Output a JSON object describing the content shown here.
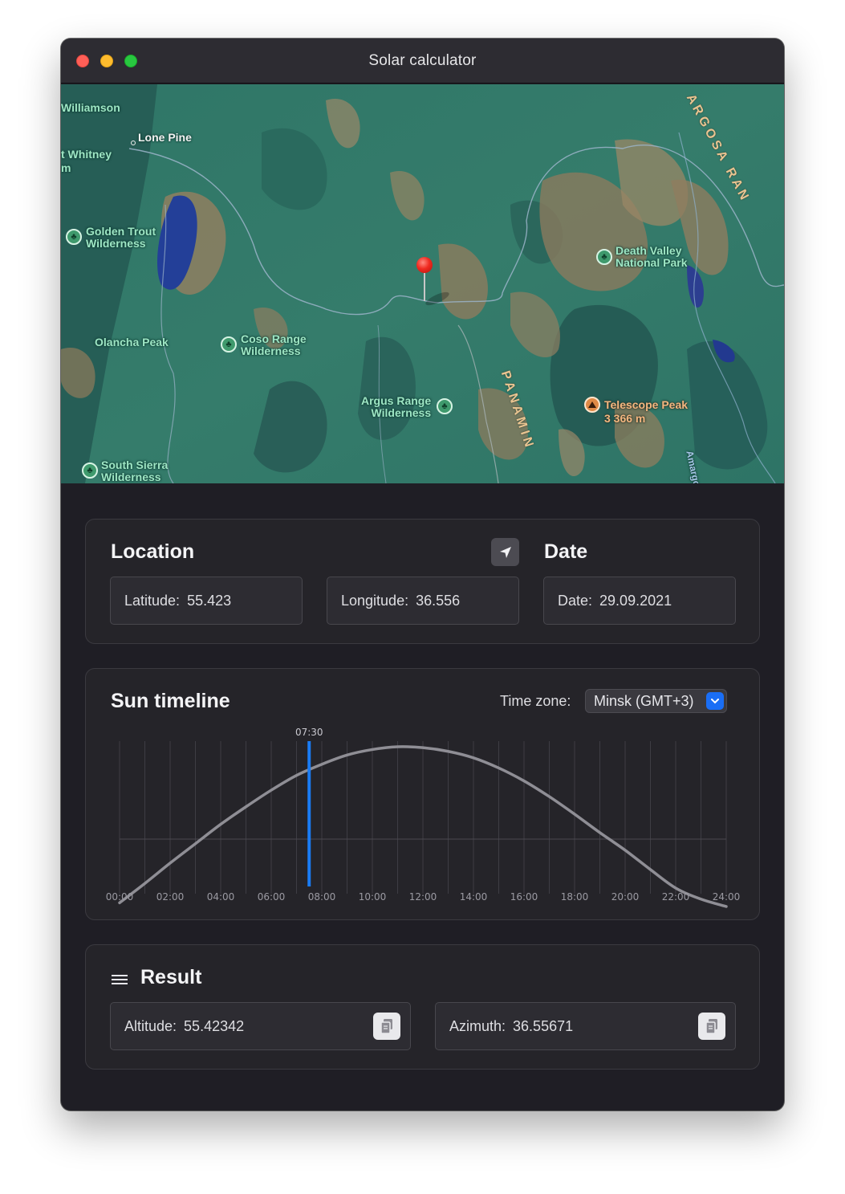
{
  "window": {
    "title": "Solar calculator"
  },
  "map": {
    "labels": {
      "williamson": "Williamson",
      "lone_pine": "Lone Pine",
      "whitney": "t Whitney",
      "whitney_m": "m",
      "golden_trout": "Golden Trout\nWilderness",
      "death_valley": "Death Valley\nNational Park",
      "olancha_peak": "Olancha Peak",
      "coso_range": "Coso Range\nWilderness",
      "argus_range": "Argus Range\nWilderness",
      "telescope_peak": "Telescope Peak",
      "telescope_elev": "3 366 m",
      "south_sierra": "South Sierra\nWilderness",
      "amargosa": "Amargosa Ri",
      "panamint": "P A N A M I N",
      "amargosa_range": "A R G O S A   R A N"
    }
  },
  "location": {
    "heading": "Location",
    "latitude_label": "Latitude:",
    "latitude_value": "55.423",
    "longitude_label": "Longitude:",
    "longitude_value": "36.556",
    "locate_icon": "location-arrow-icon"
  },
  "date": {
    "heading": "Date",
    "date_label": "Date:",
    "date_value": "29.09.2021"
  },
  "timeline": {
    "heading": "Sun timeline",
    "timezone_label": "Time zone:",
    "timezone_value": "Minsk (GMT+3)",
    "marker_label": "07:30",
    "accent": "#1a7cf5"
  },
  "chart_data": {
    "type": "line",
    "x_ticks": [
      "00:00",
      "02:00",
      "04:00",
      "06:00",
      "08:00",
      "10:00",
      "12:00",
      "14:00",
      "16:00",
      "18:00",
      "20:00",
      "22:00",
      "24:00"
    ],
    "x": [
      0,
      1,
      2,
      3,
      4,
      5,
      6,
      7,
      8,
      9,
      10,
      11,
      12,
      13,
      14,
      15,
      16,
      17,
      18,
      19,
      20,
      21,
      22,
      23,
      24
    ],
    "y": [
      -0.69,
      -0.48,
      -0.26,
      -0.05,
      0.16,
      0.35,
      0.53,
      0.69,
      0.81,
      0.91,
      0.97,
      1.0,
      0.99,
      0.95,
      0.88,
      0.77,
      0.63,
      0.46,
      0.27,
      0.07,
      -0.12,
      -0.33,
      -0.53,
      -0.65,
      -0.73
    ],
    "ylim": [
      -1,
      1
    ],
    "marker_time": 7.5,
    "grid": true
  },
  "result": {
    "heading": "Result",
    "menu_icon": "menu-icon",
    "altitude_label": "Altitude:",
    "altitude_value": "55.42342",
    "azimuth_label": "Azimuth:",
    "azimuth_value": "36.55671",
    "copy_icon": "copy-icon"
  }
}
